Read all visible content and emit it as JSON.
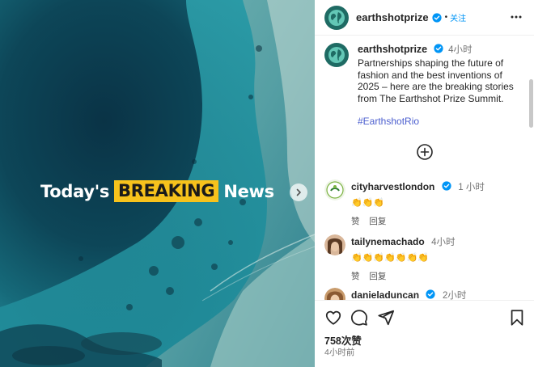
{
  "media": {
    "headline": {
      "before": "Today's",
      "highlight": "BREAKING",
      "after": "News"
    },
    "highlight_color": "#f7c21c"
  },
  "header": {
    "username": "earthshotprize",
    "separator": "•",
    "follow_label": "关注"
  },
  "caption": {
    "username": "earthshotprize",
    "time": "4小时",
    "text": "Partnerships shaping the future of fashion and the best inventions of 2025 – here are the breaking stories from The Earthshot Prize Summit.",
    "hashtag": "#EarthshotRio"
  },
  "comments": [
    {
      "username": "cityharvestlondon",
      "time": "1 小时",
      "emojis": "👏👏👏",
      "like_label": "赞",
      "reply_label": "回复"
    },
    {
      "username": "tailynemachado",
      "time": "4小时",
      "emojis": "👏👏👏👏👏👏👏",
      "like_label": "赞",
      "reply_label": "回复"
    },
    {
      "username": "danieladuncan",
      "time": "2小时",
      "emojis": "",
      "like_label": "",
      "reply_label": ""
    }
  ],
  "footer": {
    "likes": "758次赞",
    "posted": "4小时前"
  },
  "colors": {
    "link_blue": "#0095f6",
    "hashtag_blue": "#4b5ecf",
    "verified_blue": "#0095f6",
    "water_dark": "#0b3d4f",
    "water_light": "#2aa3b0"
  },
  "icons": [
    "earth-logo-icon",
    "verified-icon",
    "more-options-icon",
    "next-arrow-icon",
    "add-circle-icon",
    "heart-icon",
    "comment-icon",
    "share-icon",
    "bookmark-icon"
  ]
}
